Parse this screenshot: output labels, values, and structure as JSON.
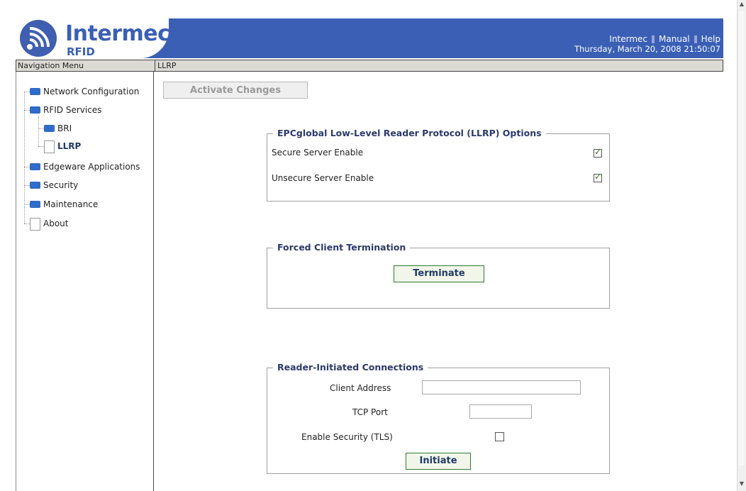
{
  "brand": {
    "name": "Intermec",
    "sub": "RFID"
  },
  "header": {
    "links": [
      "Intermec",
      "Manual",
      "Help"
    ],
    "datetime": "Thursday, March 20, 2008 21:50:07",
    "bg_color": "#3a5fb5"
  },
  "bars": {
    "nav_title": "Navigation Menu",
    "page_title": "LLRP"
  },
  "nav": {
    "items": [
      {
        "label": "Network Configuration",
        "icon": "folder-icon"
      },
      {
        "label": "RFID Services",
        "icon": "folder-icon"
      },
      {
        "label": "BRI",
        "icon": "folder-icon"
      },
      {
        "label": "LLRP",
        "icon": "page-icon",
        "selected": true
      },
      {
        "label": "Edgeware Applications",
        "icon": "folder-icon"
      },
      {
        "label": "Security",
        "icon": "folder-icon"
      },
      {
        "label": "Maintenance",
        "icon": "folder-icon"
      },
      {
        "label": "About",
        "icon": "page-icon"
      }
    ]
  },
  "main": {
    "activate_label": "Activate Changes",
    "llrp_options": {
      "legend": "EPCglobal Low-Level Reader Protocol (LLRP) Options",
      "secure_label": "Secure Server Enable",
      "secure_checked": true,
      "unsecure_label": "Unsecure Server Enable",
      "unsecure_checked": true
    },
    "termination": {
      "legend": "Forced Client Termination",
      "button_label": "Terminate"
    },
    "reader_initiated": {
      "legend": "Reader-Initiated Connections",
      "client_address_label": "Client Address",
      "client_address_value": "",
      "tcp_port_label": "TCP Port",
      "tcp_port_value": "",
      "tls_label": "Enable Security (TLS)",
      "tls_checked": false,
      "button_label": "Initiate"
    }
  }
}
